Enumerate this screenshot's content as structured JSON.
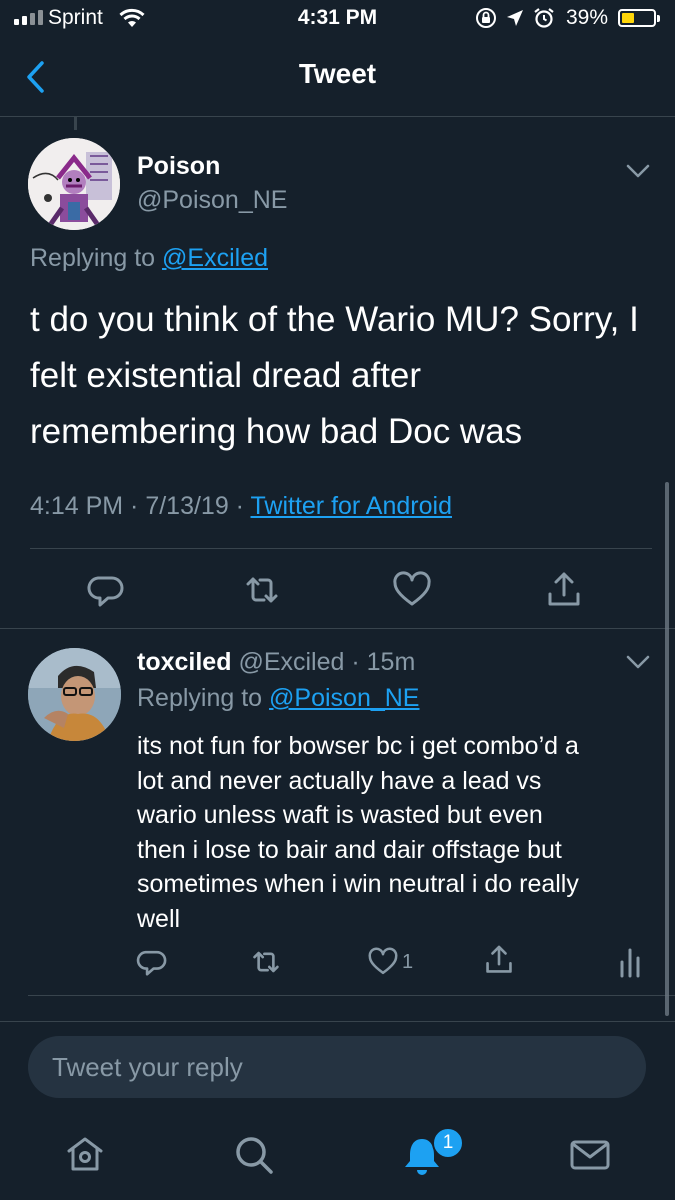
{
  "status_bar": {
    "carrier": "Sprint",
    "time": "4:31 PM",
    "battery": "39%",
    "battery_level": 0.39,
    "icons": [
      "signal-icon",
      "wifi-icon",
      "orientation-lock-icon",
      "location-icon",
      "alarm-icon",
      "battery-icon"
    ]
  },
  "header": {
    "title": "Tweet",
    "back_icon": "chevron-left-icon"
  },
  "main_tweet": {
    "name": "Poison",
    "handle": "@Poison_NE",
    "replying_prefix": "Replying to",
    "replying_to": "@Exciled",
    "lines": [
      "t do you think of the Wario MU? Sorry, I",
      "felt existential dread after",
      "remembering how bad Doc was"
    ],
    "timestamp": "4:14 PM · 7/13/19 · ",
    "source": "Twitter for Android",
    "actions": [
      "reply-icon",
      "retweet-icon",
      "like-icon",
      "share-icon"
    ]
  },
  "reply_tweet": {
    "name": "toxciled",
    "handle": "@Exciled",
    "time": "· 15m",
    "replying_prefix": "Replying to",
    "replying_to": "@Poison_NE",
    "lines": [
      "its not fun for bowser bc i get combo’d a",
      "lot and never actually have a lead vs",
      "wario unless waft is wasted but even",
      "then i lose to bair and dair offstage but",
      "sometimes when i win neutral i do really",
      "well"
    ],
    "like_count": "1",
    "actions": [
      "reply-icon",
      "retweet-icon",
      "like-icon",
      "share-icon",
      "analytics-icon"
    ]
  },
  "compose": {
    "placeholder": "Tweet your reply"
  },
  "tab_bar": {
    "tabs": [
      "home-icon",
      "search-icon",
      "notifications-icon",
      "messages-icon"
    ],
    "notification_badge": "1"
  },
  "colors": {
    "background": "#15202b",
    "accent": "#1da1f2",
    "secondary_text": "#8899a6",
    "divider": "#38444d"
  }
}
